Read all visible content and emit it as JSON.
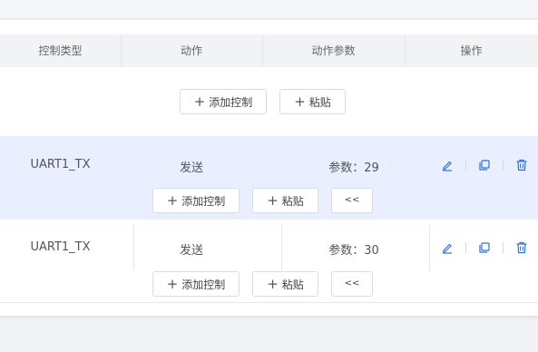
{
  "table": {
    "headers": [
      "控制类型",
      "动作",
      "动作参数",
      "操作"
    ]
  },
  "empty_row": {
    "add_label": "添加控制",
    "paste_label": "粘贴"
  },
  "rows": [
    {
      "type": "UART1_TX",
      "action": "发送",
      "param_label": "参数：",
      "param_value": "29",
      "add_label": "添加控制",
      "paste_label": "粘贴",
      "back_label": "<<",
      "highlighted": true
    },
    {
      "type": "UART1_TX",
      "action": "发送",
      "param_label": "参数：",
      "param_value": "30",
      "add_label": "添加控制",
      "paste_label": "粘贴",
      "back_label": "<<",
      "highlighted": false
    }
  ],
  "colors": {
    "accent": "#2f6fd6",
    "row_highlight": "#e9efff",
    "header_bg": "#f2f3f5"
  },
  "icons": {
    "edit": "edit-icon",
    "copy": "copy-icon",
    "delete": "trash-icon"
  }
}
